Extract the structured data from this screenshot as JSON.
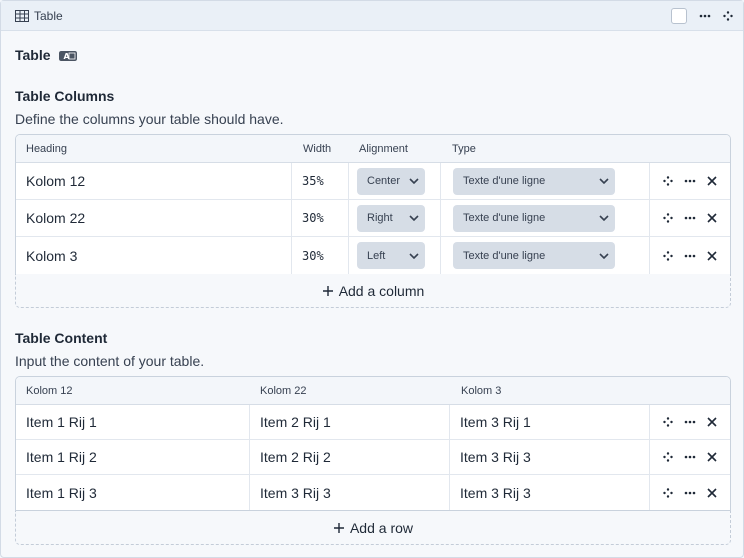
{
  "header": {
    "title": "Table"
  },
  "block_label": "Table",
  "block_badge": "A",
  "columns_section": {
    "title": "Table Columns",
    "description": "Define the columns your table should have.",
    "headers": {
      "heading": "Heading",
      "width": "Width",
      "alignment": "Alignment",
      "type": "Type"
    },
    "rows": [
      {
        "heading": "Kolom 12",
        "width": "35%",
        "alignment": "Center",
        "type": "Texte d'une ligne"
      },
      {
        "heading": "Kolom 22",
        "width": "30%",
        "alignment": "Right",
        "type": "Texte d'une ligne"
      },
      {
        "heading": "Kolom 3",
        "width": "30%",
        "alignment": "Left",
        "type": "Texte d'une ligne"
      }
    ],
    "add_label": "Add a column"
  },
  "content_section": {
    "title": "Table Content",
    "description": "Input the content of your table.",
    "headers": [
      "Kolom 12",
      "Kolom 22",
      "Kolom 3"
    ],
    "rows": [
      [
        "Item 1 Rij 1",
        "Item 2 Rij 1",
        "Item 3 Rij 1"
      ],
      [
        "Item 1 Rij 2",
        "Item 2 Rij 2",
        "Item 3 Rij 3"
      ],
      [
        "Item 1 Rij 3",
        "Item 3 Rij 3",
        "Item 3 Rij 3"
      ]
    ],
    "add_label": "Add a row"
  },
  "icons": {
    "header": [
      "table-grid-icon",
      "checkbox",
      "ellipsis-icon",
      "drag-handle-icon"
    ],
    "row_actions": [
      "drag-handle-icon",
      "ellipsis-icon",
      "close-icon"
    ],
    "add": "plus-icon",
    "select": "chevron-down-icon"
  }
}
